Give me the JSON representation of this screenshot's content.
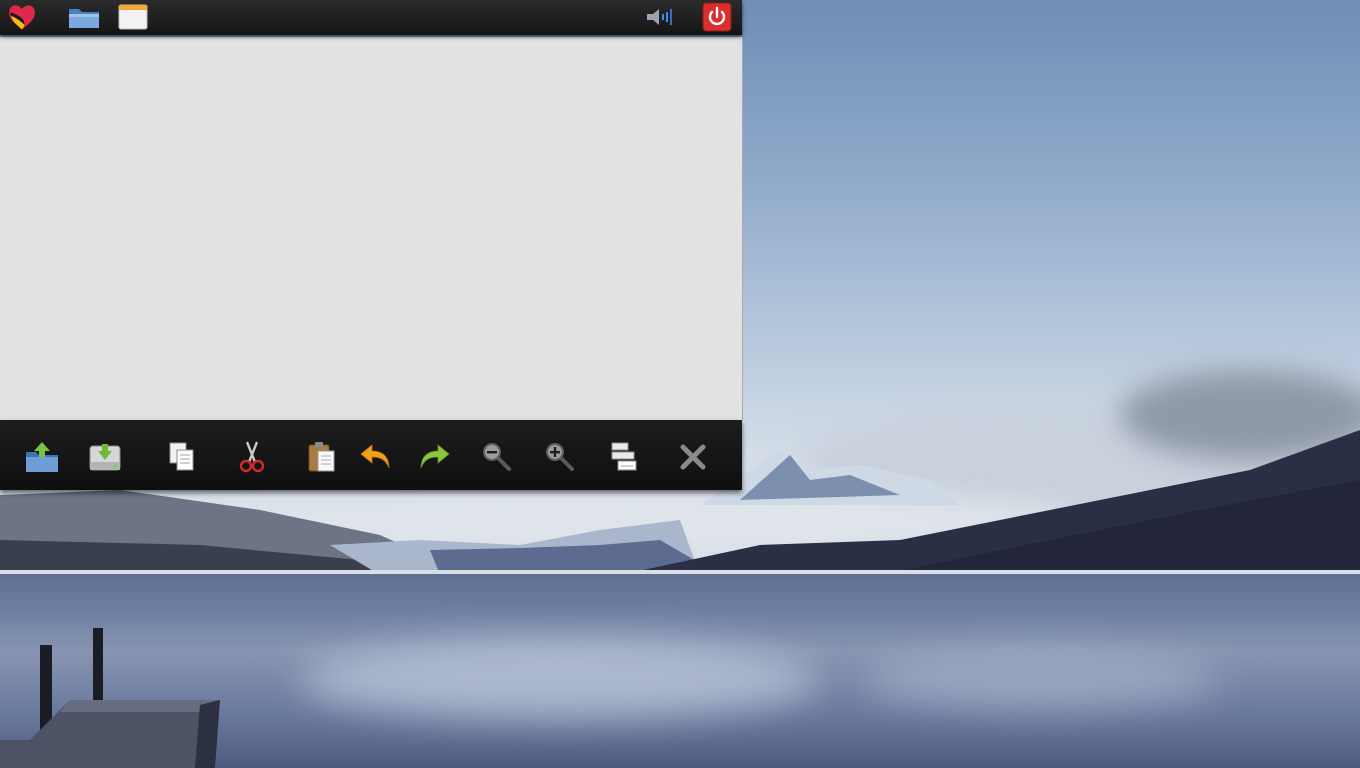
{
  "top_panel": {
    "launchers": [
      {
        "name": "app-menu",
        "icon": "heart-logo-icon"
      },
      {
        "name": "file-manager",
        "icon": "folder-icon"
      },
      {
        "name": "window-list",
        "icon": "window-icon"
      }
    ],
    "tray": {
      "volume_icon": "speaker-icon",
      "power_icon": "power-icon"
    }
  },
  "toolbar": {
    "tools": [
      {
        "name": "open",
        "icon": "folder-upload-icon"
      },
      {
        "name": "save",
        "icon": "drive-download-icon"
      },
      {
        "name": "copy",
        "icon": "copy-icon"
      },
      {
        "name": "cut",
        "icon": "scissors-icon"
      },
      {
        "name": "paste",
        "icon": "clipboard-icon"
      },
      {
        "name": "undo",
        "icon": "undo-arrow-icon"
      },
      {
        "name": "redo",
        "icon": "redo-arrow-icon"
      },
      {
        "name": "zoom-out",
        "icon": "zoom-out-icon"
      },
      {
        "name": "zoom-in",
        "icon": "zoom-in-icon"
      },
      {
        "name": "select-all",
        "icon": "select-all-icon"
      },
      {
        "name": "close",
        "icon": "close-icon"
      }
    ]
  },
  "colors": {
    "panel_bg": "#1a1a1a",
    "window_bg": "#e2e2e2",
    "power_red": "#d9302f",
    "folder_blue": "#6f9ed6",
    "undo_orange": "#f0a11c",
    "redo_green": "#8cc63f"
  }
}
